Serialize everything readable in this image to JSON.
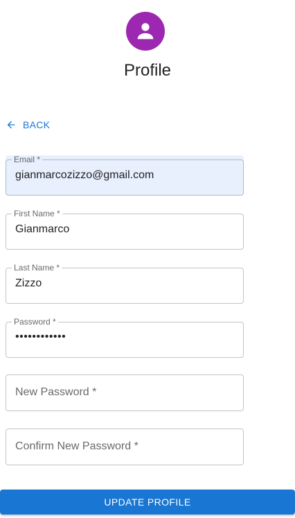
{
  "header": {
    "avatar_icon": "person-icon",
    "avatar_color": "#9c27b0",
    "title": "Profile"
  },
  "back": {
    "icon": "arrow-left-icon",
    "label": "BACK",
    "color": "#1976d2"
  },
  "form": {
    "email": {
      "label": "Email *",
      "value": "gianmarcozizzo@gmail.com"
    },
    "first_name": {
      "label": "First Name *",
      "value": "Gianmarco"
    },
    "last_name": {
      "label": "Last Name *",
      "value": "Zizzo"
    },
    "password": {
      "label": "Password *",
      "value": "••••••••••••"
    },
    "new_password": {
      "label": "New Password *",
      "value": ""
    },
    "confirm_new_password": {
      "label": "Confirm New Password *",
      "value": ""
    }
  },
  "actions": {
    "update_label": "UPDATE PROFILE",
    "update_color": "#1976d2"
  }
}
